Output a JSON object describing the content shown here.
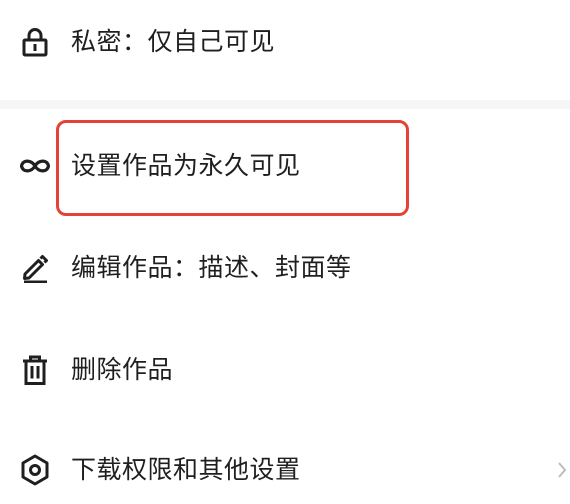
{
  "menu": {
    "privacy": {
      "label": "私密：仅自己可见",
      "icon": "lock-icon"
    },
    "permanent": {
      "label": "设置作品为永久可见",
      "icon": "infinity-icon"
    },
    "edit": {
      "label": "编辑作品：描述、封面等",
      "icon": "pencil-icon"
    },
    "delete": {
      "label": "删除作品",
      "icon": "trash-icon"
    },
    "download": {
      "label": "下载权限和其他设置",
      "icon": "hexagon-settings-icon"
    }
  },
  "colors": {
    "text": "#1f1f1f",
    "highlight": "#e44236",
    "divider": "#f6f6f6",
    "chevron": "#bdbdbd"
  }
}
